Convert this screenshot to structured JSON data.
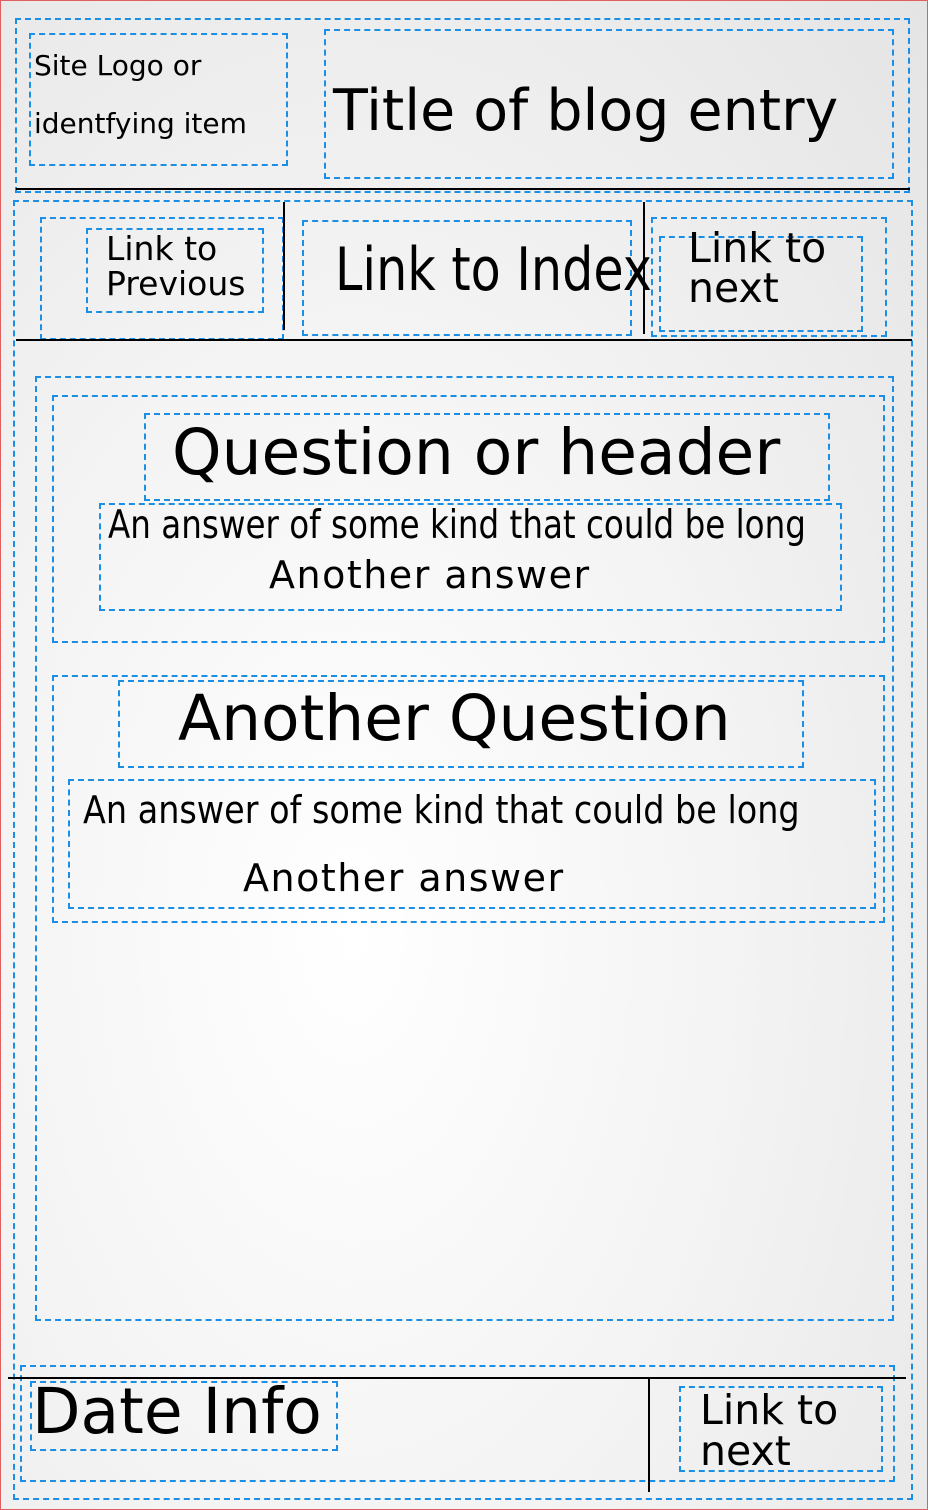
{
  "header": {
    "logo_line1": "Site Logo or",
    "logo_line2": "identfying item",
    "title": "Title of blog entry"
  },
  "nav": {
    "previous_line1": "Link to",
    "previous_line2": "Previous",
    "index": "Link to Index",
    "next_line1": "Link to",
    "next_line2": "next"
  },
  "content": {
    "sections": [
      {
        "heading": "Question or header",
        "answer1": "An answer of some kind that could be long",
        "answer2": "Another answer"
      },
      {
        "heading": "Another Question",
        "answer1": "An answer of some kind that could be long",
        "answer2": "Another answer"
      }
    ]
  },
  "footer": {
    "date": "Date Info",
    "next_line1": "Link to",
    "next_line2": "next"
  },
  "colors": {
    "wireframe_dash": "#1a8fe3",
    "border": "#e06060"
  }
}
